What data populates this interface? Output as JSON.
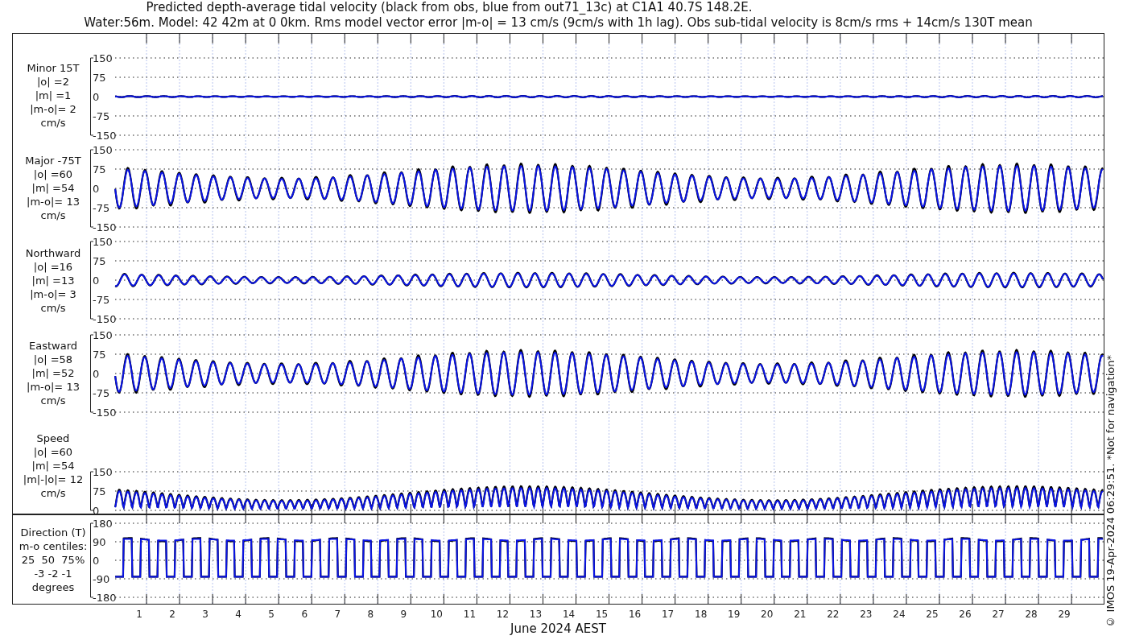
{
  "title": [
    "Predicted depth-average tidal velocity (black from obs, blue from out71_13c) at C1A1 40.7S 148.2E.",
    "Water:56m. Model: 42 42m at 0 0km. Rms model vector error |m-o| = 13 cm/s (9cm/s with 1h lag). Obs sub-tidal velocity is 8cm/s rms + 14cm/s 130T mean"
  ],
  "panels": [
    {
      "kind": "velocity",
      "label": [
        "Minor 15T",
        "|o| =2",
        "|m| =1",
        "|m-o|= 2",
        "cm/s"
      ],
      "yticks": [
        "150",
        "75",
        "0",
        "-75",
        "-150"
      ]
    },
    {
      "kind": "velocity",
      "label": [
        "Major -75T",
        "|o| =60",
        "|m| =54",
        "|m-o|= 13",
        "cm/s"
      ],
      "yticks": [
        "150",
        "75",
        "0",
        "-75",
        "-150"
      ]
    },
    {
      "kind": "velocity",
      "label": [
        "Northward",
        "|o| =16",
        "|m| =13",
        "|m-o|= 3",
        "cm/s"
      ],
      "yticks": [
        "150",
        "75",
        "0",
        "-75",
        "-150"
      ]
    },
    {
      "kind": "velocity",
      "label": [
        "Eastward",
        "|o| =58",
        "|m| =52",
        "|m-o|= 13",
        "cm/s"
      ],
      "yticks": [
        "150",
        "75",
        "0",
        "-75",
        "-150"
      ]
    },
    {
      "kind": "speed",
      "label": [
        "Speed",
        "|o| =60",
        "|m| =54",
        "|m|-|o|= 12",
        "cm/s"
      ],
      "yticks": [
        "150",
        "75",
        "0"
      ]
    }
  ],
  "direction_panel": {
    "kind": "direction",
    "label": [
      "Direction (T)",
      "m-o centiles:",
      "25  50  75%",
      "-3 -2 -1",
      "degrees"
    ],
    "yticks": [
      "180",
      "90",
      "0",
      "-90",
      "-180"
    ]
  },
  "x_axis": {
    "ticks": [
      "1",
      "2",
      "3",
      "4",
      "5",
      "6",
      "7",
      "8",
      "9",
      "10",
      "11",
      "12",
      "13",
      "14",
      "15",
      "16",
      "17",
      "18",
      "19",
      "20",
      "21",
      "22",
      "23",
      "24",
      "25",
      "26",
      "27",
      "28",
      "29"
    ],
    "label": "June 2024 AEST"
  },
  "credit": "© IMOS 19-Apr-2024 06:29:51. *Not for navigation*"
}
